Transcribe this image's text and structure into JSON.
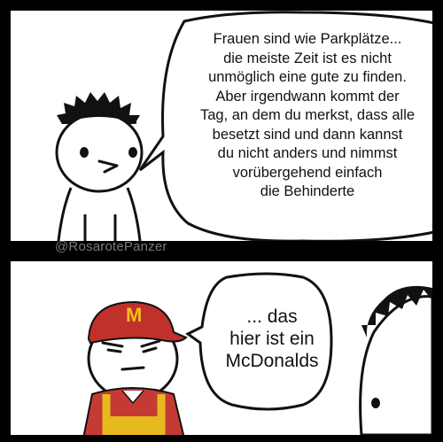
{
  "watermark": "@RosarotePanzer",
  "panel_top": {
    "speech": [
      "Frauen sind wie Parkplätze...",
      "die meiste Zeit ist es nicht",
      "unmöglich eine gute zu finden.",
      "Aber irgendwann kommt der",
      "Tag, an dem du merkst, dass alle",
      "besetzt sind und dann kannst",
      "du nicht anders und nimmst",
      "vorübergehend einfach",
      "die Behinderte"
    ]
  },
  "panel_bottom": {
    "speech": [
      "... das",
      "hier ist ein",
      "McDonalds"
    ],
    "cap_logo": "M"
  },
  "colors": {
    "cap_red": "#c0312b",
    "logo_yellow": "#f2c01d",
    "shirt_red": "#c63a35",
    "apron_yellow": "#e6b91f"
  }
}
